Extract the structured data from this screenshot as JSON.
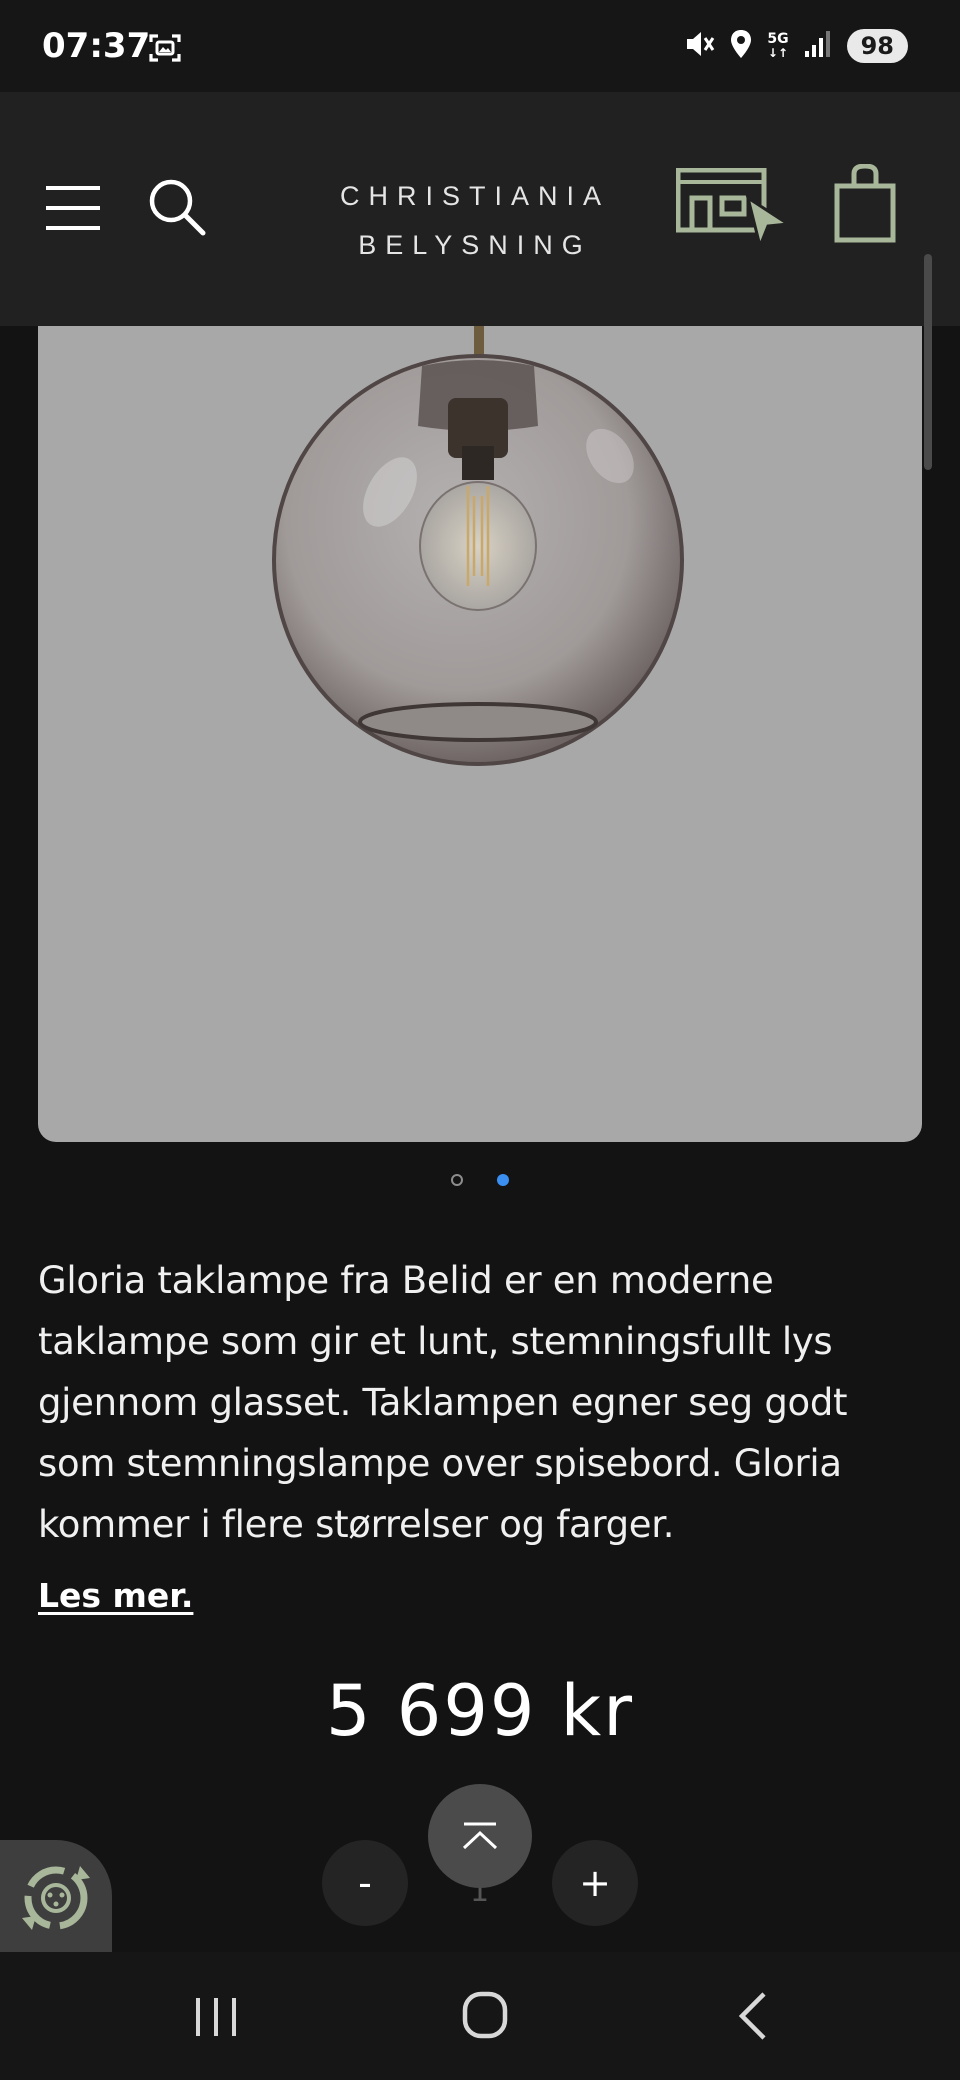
{
  "status_bar": {
    "time": "07:37",
    "network_label": "5G",
    "battery": "98",
    "icons": [
      "screenshot-icon",
      "mute-icon",
      "location-icon",
      "signal-icon"
    ]
  },
  "header": {
    "logo_line1": "CHRISTIANIA",
    "logo_line2": "BELYSNING",
    "icons": [
      "menu-icon",
      "search-icon",
      "store-icon",
      "shopping-bag-icon"
    ],
    "accent_color": "#a8b79a"
  },
  "product": {
    "image_alt": "Gloria taklampe",
    "carousel": {
      "total": 2,
      "active_index": 1
    },
    "description": "Gloria taklampe fra Belid er en moderne taklampe som gir et lunt, stemningsfullt lys gjennom glasset. Taklampen egner seg godt som stemningslampe over spisebord. Gloria kommer i flere størrelser og farger.",
    "read_more": "Les mer.",
    "price": "5 699 kr",
    "quantity": "1",
    "minus_label": "-",
    "plus_label": "+"
  },
  "colors": {
    "background": "#141314",
    "header": "#212121",
    "image_bg": "#a9a8a9",
    "active_dot": "#3a8ff0"
  }
}
